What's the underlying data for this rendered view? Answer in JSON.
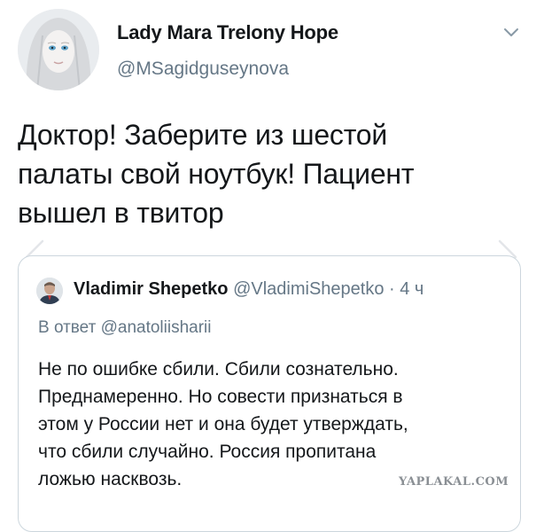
{
  "author": {
    "name": "Lady Mara Trelony Hope",
    "handle": "@MSagidguseynova"
  },
  "tweet": {
    "text": "Доктор! Заберите из шестой\nпалаты свой ноутбук! Пациент\nвышел в твитор"
  },
  "quoted": {
    "name": "Vladimir Shepetko",
    "handle": "@VladimiShepetko",
    "time": "· 4 ч",
    "reply_to": "В ответ @anatoliisharii",
    "text": "Не по ошибке сбили. Сбили сознательно.\nПреднамеренно. Но совести признаться в\nэтом у России нет и она будет утверждать,\nчто сбили случайно. Россия пропитана\nложью насквозь."
  },
  "watermark": "YAPLAKAL.COM",
  "icons": {
    "menu": "chevron-down-icon",
    "nav_prev": "chevron-left-icon",
    "nav_next": "chevron-right-icon"
  },
  "colors": {
    "text_primary": "#14171a",
    "text_secondary": "#657786",
    "border": "#ccd6dd"
  }
}
